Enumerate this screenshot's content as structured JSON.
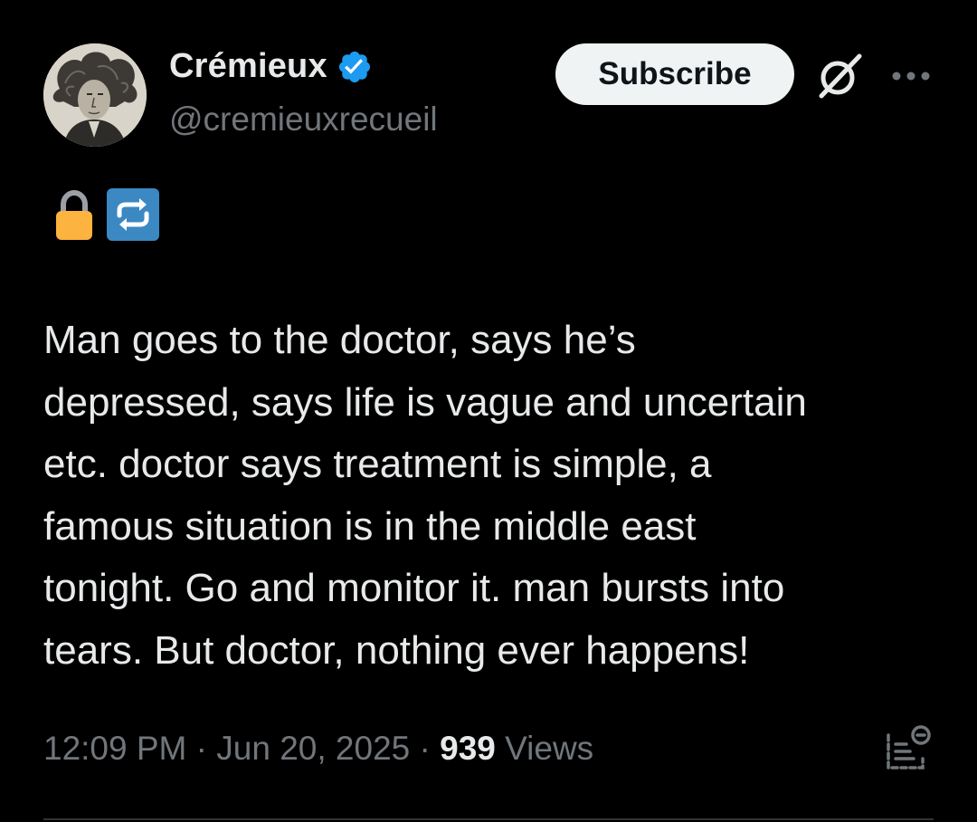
{
  "author": {
    "name": "Crémieux",
    "handle": "@cremieuxrecueil",
    "verified": true,
    "verified_color": "#1d9bf0"
  },
  "header": {
    "subscribe_label": "Subscribe",
    "icons": [
      "grok-icon",
      "more-icon"
    ]
  },
  "bio_emojis": [
    "lock-icon",
    "repeat-icon"
  ],
  "tweet": {
    "text": "Man goes to the doctor, says he’s\ndepressed, says life is vague and uncertain\netc. doctor says treatment is simple, a\nfamous situation is in the middle east\ntonight. Go and monitor it. man bursts into\ntears. But doctor, nothing ever happens!",
    "time": "12:09 PM",
    "separator": " · ",
    "date": "Jun 20, 2025",
    "views_count": "939",
    "views_label": " Views"
  },
  "colors": {
    "background": "#000000",
    "primary_text": "#e7e9ea",
    "secondary_text": "#71767b",
    "accent": "#1d9bf0"
  }
}
